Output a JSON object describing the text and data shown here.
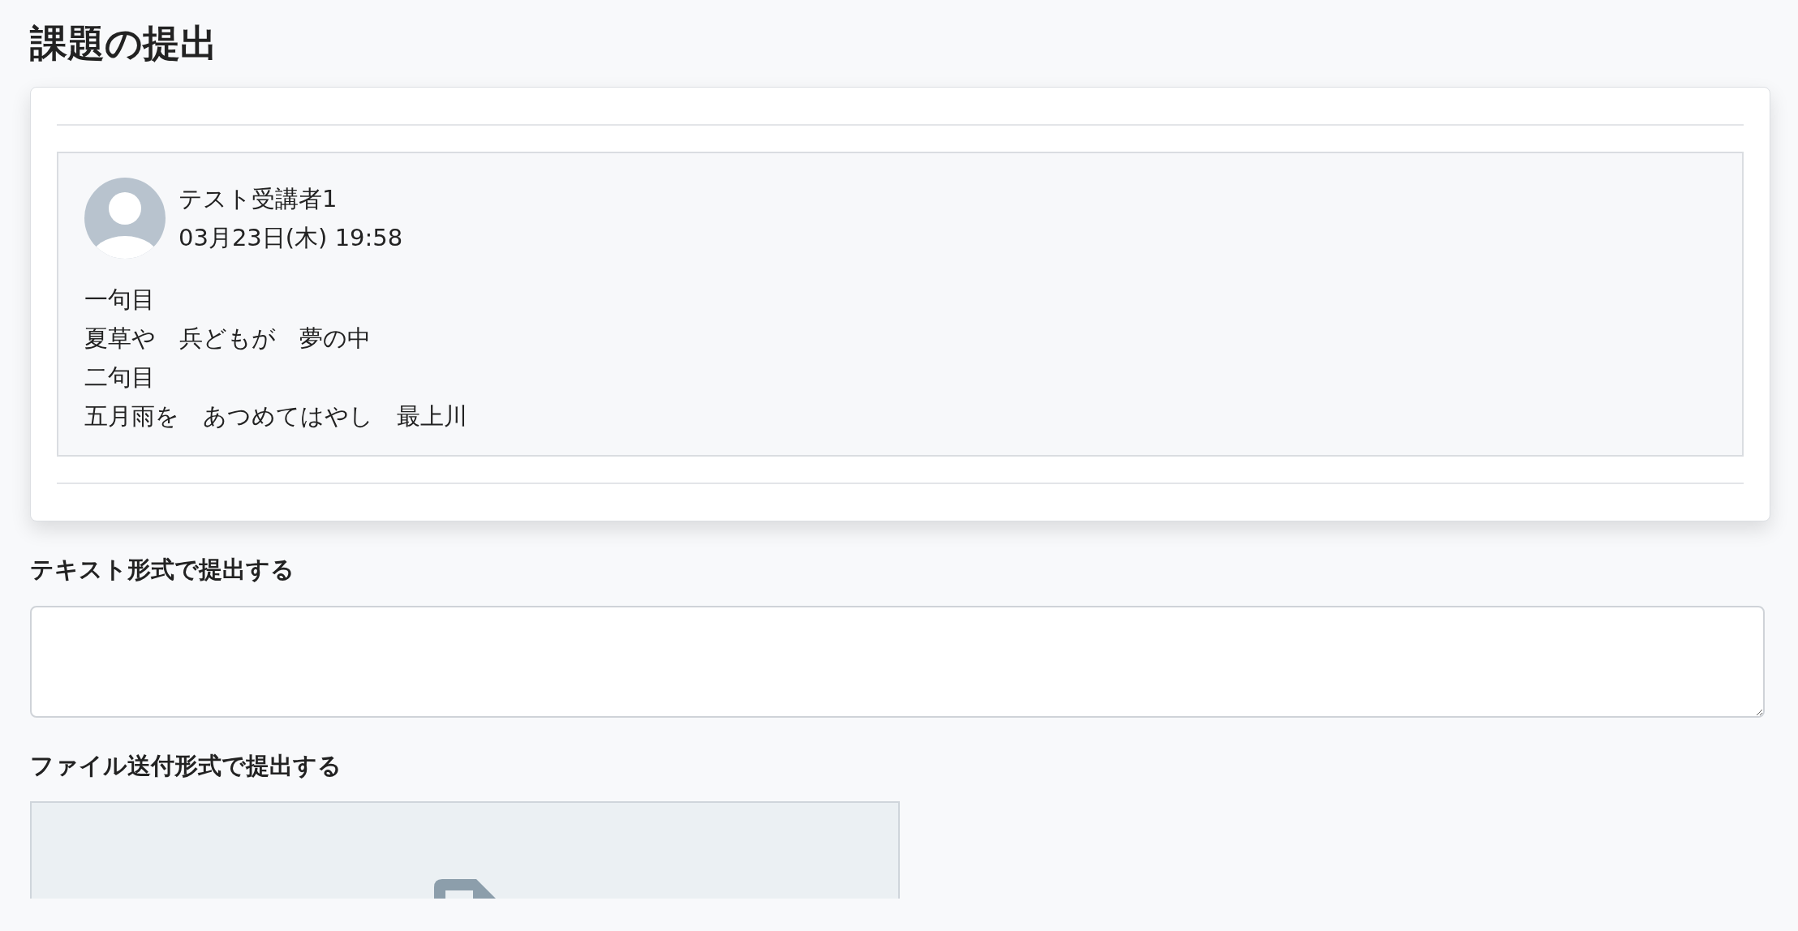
{
  "page": {
    "title": "課題の提出"
  },
  "submission": {
    "author": "テスト受講者1",
    "date": "03月23日(木) 19:58",
    "body_lines": [
      "一句目",
      "夏草や　兵どもが　夢の中",
      "二句目",
      "五月雨を　あつめてはやし　最上川"
    ]
  },
  "text_form": {
    "label": "テキスト形式で提出する"
  },
  "file_form": {
    "label": "ファイル送付形式で提出する"
  }
}
